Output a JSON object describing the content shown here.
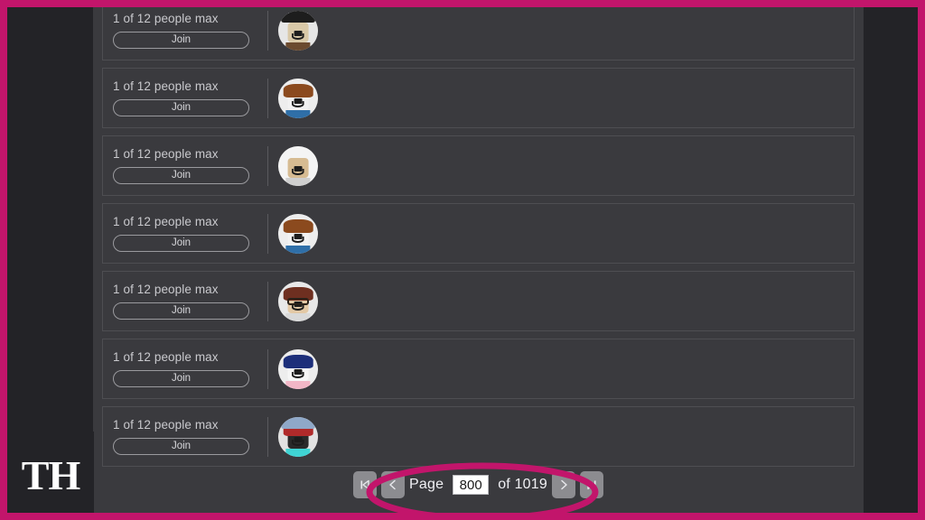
{
  "window": {
    "background_color": "#232327",
    "panel_color": "#3a3a3e",
    "border_color": "#c2156b"
  },
  "server_list": {
    "card_border_color": "#4e4e52",
    "join_label": "Join",
    "servers": [
      {
        "capacity_text": "1 of 12 people max",
        "join_label": "Join",
        "avatar": {
          "name": "avatar-black-hat-character",
          "skin": "#d9c9a8",
          "hair": "#1d1d1d",
          "hat": "#1d1d1d",
          "shirt": "#6b4a2f",
          "bg": "#e6e6e6",
          "has_hat": true,
          "has_hair": false,
          "has_glasses": false
        }
      },
      {
        "capacity_text": "1 of 12 people max",
        "join_label": "Join",
        "avatar": {
          "name": "avatar-brown-hair-character",
          "skin": "#f2f2f2",
          "hair": "#8b4a1e",
          "hat": "",
          "shirt": "#2f6fa8",
          "bg": "#ededed",
          "has_hat": false,
          "has_hair": true,
          "has_glasses": false
        }
      },
      {
        "capacity_text": "1 of 12 people max",
        "join_label": "Join",
        "avatar": {
          "name": "avatar-bald-character",
          "skin": "#d6bb92",
          "hair": "#d8d8d8",
          "hat": "",
          "shirt": "#cfcfcf",
          "bg": "#f4f4f4",
          "has_hat": false,
          "has_hair": false,
          "has_glasses": false
        }
      },
      {
        "capacity_text": "1 of 12 people max",
        "join_label": "Join",
        "avatar": {
          "name": "avatar-brown-hair-character",
          "skin": "#f2f2f2",
          "hair": "#8b4a1e",
          "hat": "",
          "shirt": "#2f6fa8",
          "bg": "#ededed",
          "has_hat": false,
          "has_hair": true,
          "has_glasses": false
        }
      },
      {
        "capacity_text": "1 of 12 people max",
        "join_label": "Join",
        "avatar": {
          "name": "avatar-glasses-character",
          "skin": "#e3c9a6",
          "hair": "#6e2f20",
          "hat": "",
          "shirt": "#d9d9d9",
          "bg": "#e8e8e8",
          "has_hat": false,
          "has_hair": true,
          "has_glasses": true
        }
      },
      {
        "capacity_text": "1 of 12 people max",
        "join_label": "Join",
        "avatar": {
          "name": "avatar-blue-hair-character",
          "skin": "#f6f6f6",
          "hair": "#1d2f7a",
          "hat": "",
          "shirt": "#f2b6c6",
          "bg": "#ededed",
          "has_hat": false,
          "has_hair": true,
          "has_glasses": false
        }
      },
      {
        "capacity_text": "1 of 12 people max",
        "join_label": "Join",
        "avatar": {
          "name": "avatar-blue-cap-character",
          "skin": "#2a2a2a",
          "hair": "#b02a2a",
          "hat": "#8fa8c8",
          "shirt": "#3fd4d4",
          "bg": "#e2e2e2",
          "has_hat": true,
          "has_hair": true,
          "has_glasses": false
        }
      }
    ]
  },
  "pagination": {
    "first_page_label": "|◀",
    "prev_page_label": "◀",
    "page_label": "Page",
    "current_page": "800",
    "of_label": "of 1019",
    "total_pages": "1019",
    "next_page_label": "▶",
    "last_page_label": "▶|"
  },
  "annotation": {
    "shape": "ellipse",
    "color": "#c2156b",
    "stroke_width": 7
  },
  "watermark": {
    "text": "TH"
  }
}
